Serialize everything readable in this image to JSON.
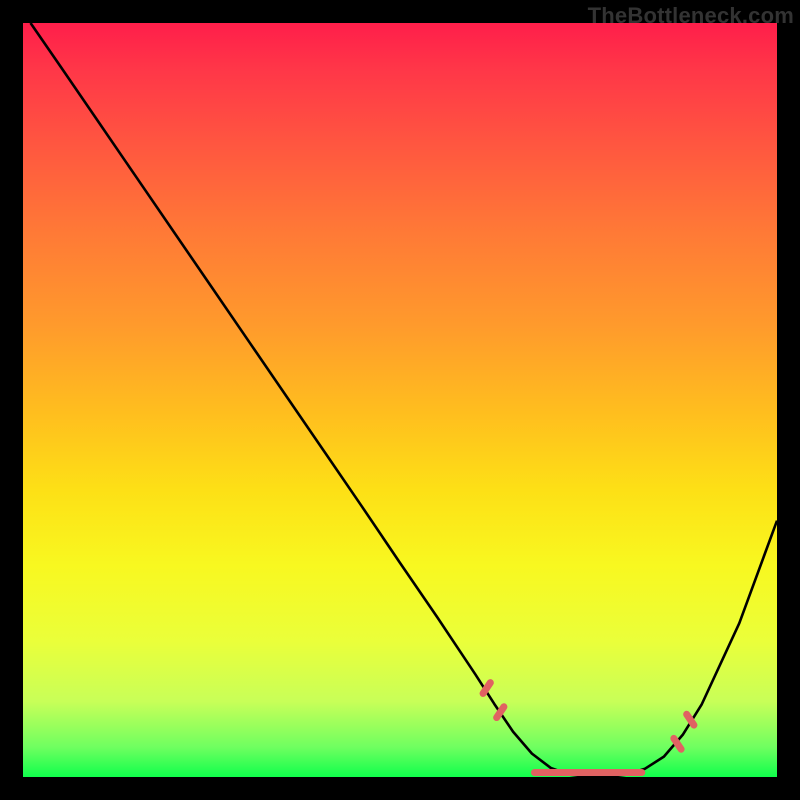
{
  "watermark": "TheBottleneck.com",
  "chart_data": {
    "type": "line",
    "title": "",
    "xlabel": "",
    "ylabel": "",
    "xlim": [
      0,
      100
    ],
    "ylim": [
      0,
      100
    ],
    "series": [
      {
        "name": "bottleneck-curve",
        "color": "#000000",
        "x": [
          1,
          5,
          10,
          15,
          20,
          25,
          30,
          35,
          40,
          45,
          50,
          55,
          58,
          60,
          62.5,
          65,
          67.5,
          70,
          72.5,
          75,
          77.5,
          80,
          82.5,
          85,
          87.5,
          90,
          95,
          100
        ],
        "y": [
          100,
          94.2,
          86.9,
          79.6,
          72.3,
          65,
          57.7,
          50.4,
          43.1,
          35.8,
          28.4,
          21.1,
          16.6,
          13.6,
          9.7,
          6,
          3.1,
          1.2,
          0.3,
          0,
          0,
          0.3,
          1.1,
          2.7,
          5.6,
          9.6,
          20.4,
          34
        ]
      }
    ],
    "markers": {
      "name": "optimal-zone-markers",
      "color": "#e06262",
      "points": [
        {
          "x": 61.5,
          "y": 11.8
        },
        {
          "x": 63.3,
          "y": 8.6
        },
        {
          "x": 68.7,
          "y": 0.6
        },
        {
          "x": 70.5,
          "y": 0.6
        },
        {
          "x": 72.3,
          "y": 0.6
        },
        {
          "x": 74.1,
          "y": 0.6
        },
        {
          "x": 75.9,
          "y": 0.6
        },
        {
          "x": 77.7,
          "y": 0.6
        },
        {
          "x": 79.5,
          "y": 0.6
        },
        {
          "x": 81.2,
          "y": 0.6
        },
        {
          "x": 86.8,
          "y": 4.4
        },
        {
          "x": 88.5,
          "y": 7.6
        }
      ]
    },
    "background_gradient": {
      "top": "#ff1e4a",
      "upper_mid": "#ff9a2c",
      "lower_mid": "#f8f820",
      "bottom": "#10ff4c"
    }
  }
}
